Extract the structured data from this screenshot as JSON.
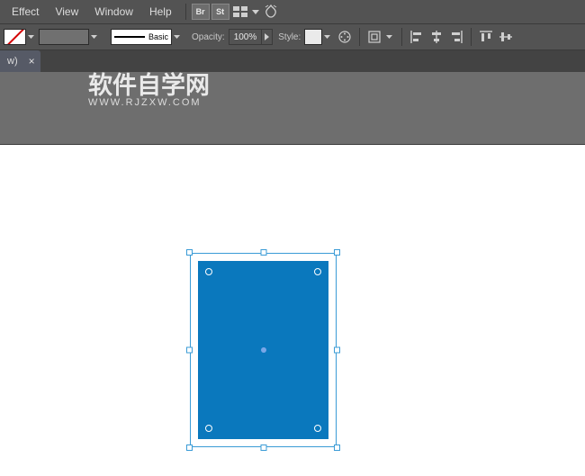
{
  "menu": {
    "items": [
      "Effect",
      "View",
      "Window",
      "Help"
    ]
  },
  "menu_icons": {
    "bridge": "Br",
    "stock": "St"
  },
  "options": {
    "stroke_style_label": "Basic",
    "opacity_label": "Opacity:",
    "opacity_value": "100%",
    "style_label": "Style:"
  },
  "tab": {
    "label": "w)",
    "close_glyph": "×"
  },
  "watermark": {
    "cn": "软件自学网",
    "en": "WWW.RJZXW.COM"
  },
  "shape": {
    "fill": "#0a78bd"
  }
}
